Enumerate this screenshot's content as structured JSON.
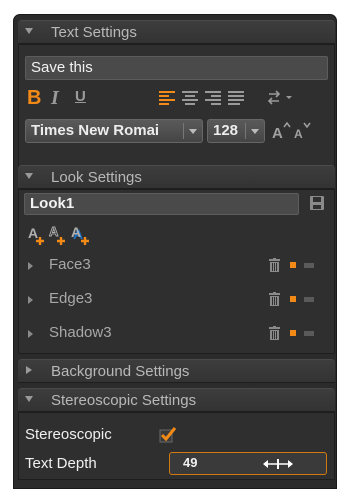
{
  "text_settings": {
    "header": "Text Settings",
    "text_value": "Save this",
    "font_name": "Times New Romai",
    "font_size": "128",
    "accent_color": "#f28a18"
  },
  "look_settings": {
    "header": "Look Settings",
    "look_name": "Look1",
    "items": [
      {
        "label": "Face3"
      },
      {
        "label": "Edge3"
      },
      {
        "label": "Shadow3"
      }
    ]
  },
  "background_settings": {
    "header": "Background Settings"
  },
  "stereoscopic_settings": {
    "header": "Stereoscopic Settings",
    "stereoscopic_label": "Stereoscopic",
    "stereoscopic_checked": true,
    "text_depth_label": "Text Depth",
    "text_depth_value": "49"
  },
  "icons": {
    "bold": "B",
    "italic": "I",
    "underline": "U"
  }
}
